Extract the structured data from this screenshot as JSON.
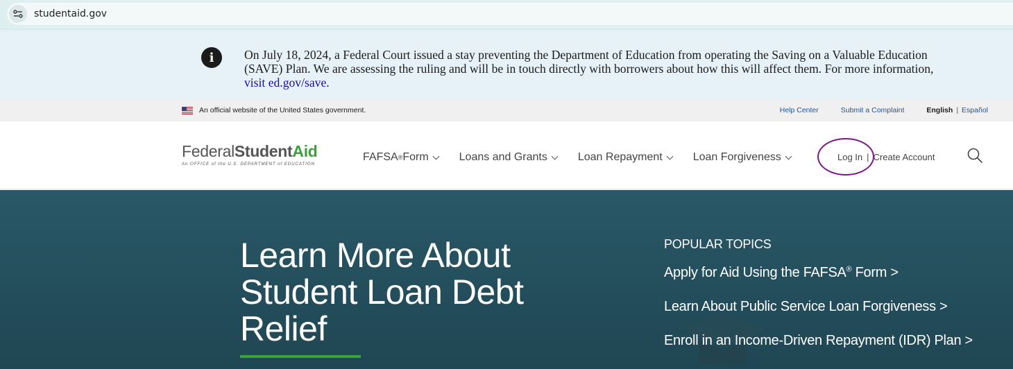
{
  "browser": {
    "url": "studentaid.gov",
    "site_info_icon": "tune-icon"
  },
  "alert": {
    "icon": "info-icon",
    "text_before": "On July 18, 2024, a Federal Court issued a stay preventing the Department of Education from operating the Saving on a Valuable Education (SAVE) Plan. We are assessing the ruling and will be in touch directly with borrowers about how this will affect them. For more information, ",
    "link_text": "visit ed.gov/save",
    "text_after": "."
  },
  "gov_banner": {
    "text": "An official website of the United States government.",
    "help_center": "Help Center",
    "submit_complaint": "Submit a Complaint",
    "lang_english": "English",
    "lang_sep": "|",
    "lang_spanish": "Español"
  },
  "logo": {
    "federal": "Federal",
    "student": "Student",
    "aid": "Aid",
    "tagline": "An OFFICE of the U.S. DEPARTMENT of EDUCATION"
  },
  "nav": {
    "fafsa": "FAFSA",
    "fafsa_reg": "®",
    "fafsa_rest": " Form",
    "loans_grants": "Loans and Grants",
    "loan_repayment": "Loan Repayment",
    "loan_forgiveness": "Loan Forgiveness"
  },
  "account": {
    "login": "Log In",
    "sep": "|",
    "create": "Create Account"
  },
  "hero": {
    "title": "Learn More About Student Loan Debt Relief",
    "popular_heading": "POPULAR TOPICS",
    "topic1_a": "Apply for Aid Using the FAFSA",
    "topic1_reg": "®",
    "topic1_b": " Form >",
    "topic2": "Learn About Public Service Loan Forgiveness >",
    "topic3": "Enroll in an Income-Driven Repayment (IDR) Plan >"
  },
  "colors": {
    "hero_bg": "#2a5867",
    "accent_green": "#3aa337",
    "link_blue": "#205493",
    "annotation_purple": "#7a1a86"
  }
}
